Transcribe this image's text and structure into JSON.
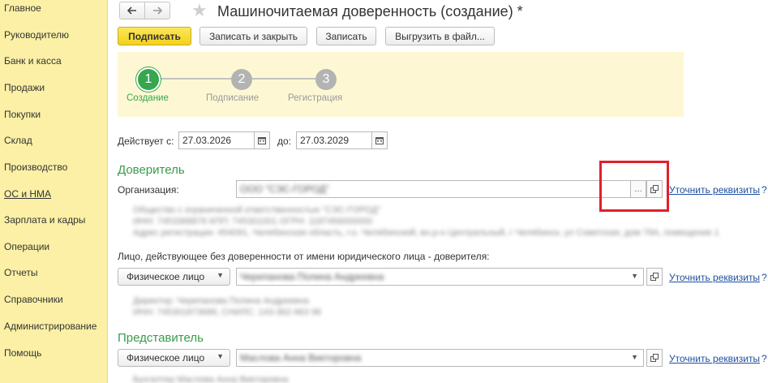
{
  "sidebar": {
    "items": [
      {
        "label": "Главное"
      },
      {
        "label": "Руководителю"
      },
      {
        "label": "Банк и касса"
      },
      {
        "label": "Продажи"
      },
      {
        "label": "Покупки"
      },
      {
        "label": "Склад"
      },
      {
        "label": "Производство"
      },
      {
        "label": "ОС и НМА"
      },
      {
        "label": "Зарплата и кадры"
      },
      {
        "label": "Операции"
      },
      {
        "label": "Отчеты"
      },
      {
        "label": "Справочники"
      },
      {
        "label": "Администрирование"
      },
      {
        "label": "Помощь"
      }
    ]
  },
  "header": {
    "title": "Машиночитаемая доверенность (создание) *",
    "back_icon": "arrow-left-icon",
    "forward_icon": "arrow-right-icon",
    "favorite_icon": "star-icon"
  },
  "toolbar": {
    "sign_label": "Подписать",
    "save_close_label": "Записать и закрыть",
    "save_label": "Записать",
    "export_label": "Выгрузить в файл..."
  },
  "steps": [
    {
      "number": "1",
      "label": "Создание"
    },
    {
      "number": "2",
      "label": "Подписание"
    },
    {
      "number": "3",
      "label": "Регистрация"
    }
  ],
  "validity": {
    "from_label": "Действует с:",
    "from_value": "27.03.2026",
    "to_label": "до:",
    "to_value": "27.03.2029"
  },
  "principal": {
    "heading": "Доверитель",
    "org_label": "Организация:",
    "org_value": "ООО \"СЭС-ГОРОД\"",
    "org_details": [
      "Общество с ограниченной ответственностью \"СЭС-ГОРОД\"",
      "ИНН: 7453368876 КПП: 745301001 ОГРН: 1187456000000",
      "Адрес регистрации: 454091, Челябинская область, г.о. Челябинский, вн.р-н Центральный, г Челябинск, ул Советская, дом 78А, помещение 1"
    ],
    "clarify_label": "Уточнить реквизиты",
    "help": "?",
    "person_label": "Лицо, действующее без доверенности от имени юридического лица - доверителя:",
    "person_type": "Физическое лицо",
    "person_value": "Черепанова Полина Андреевна",
    "person_details": [
      "Директор: Черепанова Полина Андреевна",
      "ИНН: 745301873686, СНИЛС: 143-362-963 96"
    ]
  },
  "representative": {
    "heading": "Представитель",
    "person_type": "Физическое лицо",
    "person_value": "Маслова Анна Викторовна",
    "details": "Бухгалтер Маслова Анна Викторовна",
    "clarify_label": "Уточнить реквизиты",
    "help": "?"
  },
  "colors": {
    "sidebar_bg": "#fbf0a5",
    "accent_green": "#3a9b4c",
    "primary_button": "#f5d52a",
    "highlight": "#e0202a",
    "link": "#1f4fa0"
  }
}
